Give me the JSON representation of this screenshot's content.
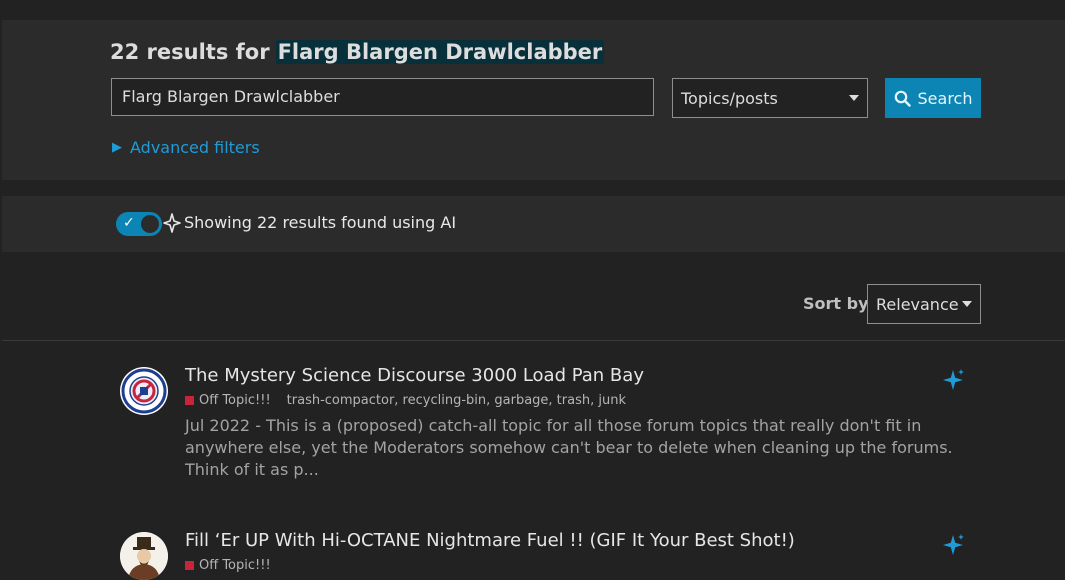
{
  "header": {
    "prefix": "22 results for",
    "term": "Flarg Blargen Drawlclabber"
  },
  "search": {
    "query": "Flarg Blargen Drawlclabber",
    "type_selected": "Topics/posts",
    "button_label": "Search",
    "advanced_label": "Advanced filters"
  },
  "ai": {
    "enabled": true,
    "message": "Showing 22 results found using AI"
  },
  "sort": {
    "label": "Sort by",
    "selected": "Relevance"
  },
  "results": [
    {
      "title": "The Mystery Science Discourse 3000 Load Pan Bay",
      "category": "Off Topic!!!",
      "tags": "trash-compactor, recycling-bin, garbage, trash, junk",
      "blurb": "Jul 2022 - This is a (proposed) catch-all topic for all those forum topics that really don't fit in anywhere else, yet the Moderators somehow can't bear to delete when cleaning up the forums. Think of it as p..."
    },
    {
      "title": "Fill ‘Er UP With Hi-OCTANE Nightmare Fuel !! (GIF It Your Best Shot!)",
      "category": "Off Topic!!!",
      "tags": "",
      "blurb": ""
    }
  ],
  "colors": {
    "accent": "#0c85b4",
    "link": "#1f9bd8",
    "category": "#c8243c",
    "highlight": "#08303a"
  }
}
